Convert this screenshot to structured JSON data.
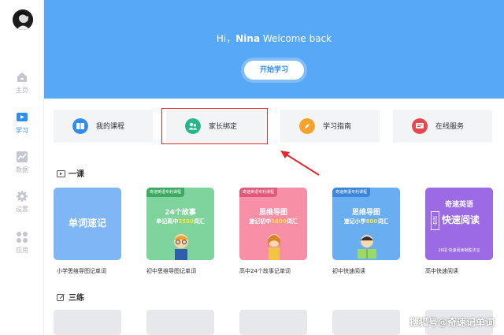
{
  "sidebar": {
    "items": [
      {
        "label": "主页"
      },
      {
        "label": "学习"
      },
      {
        "label": "数据"
      },
      {
        "label": "设置"
      },
      {
        "label": "应用"
      }
    ]
  },
  "hero": {
    "greeting_prefix": "Hi，",
    "user_name": "Nina",
    "greeting_suffix": "Welcome back",
    "start_button": "开始学习"
  },
  "quick_cards": [
    {
      "label": "我的课程"
    },
    {
      "label": "家长绑定"
    },
    {
      "label": "学习指南"
    },
    {
      "label": "在线服务"
    }
  ],
  "sections": {
    "lesson_title": "一课",
    "practice_title": "三练"
  },
  "books": [
    {
      "tag": "",
      "line1": "单词速记",
      "line2": "",
      "label": "小学思维导图记单词"
    },
    {
      "tag": "奇速英语专利课程",
      "line1": "24个故事",
      "line2_a": "串记高中",
      "line2_hl": "3500",
      "line2_b": "词汇",
      "label": "初中思维导图记单词"
    },
    {
      "tag": "奇速英语专利课程",
      "line1": "思维导图",
      "line2_a": "速记初中",
      "line2_hl": "1600",
      "line2_b": "词汇",
      "label": "高中24个故事记单词"
    },
    {
      "tag": "奇速英语专利课程",
      "line1": "思维导图",
      "line2_a": "速记小学",
      "line2_hl": "800",
      "line2_b": "词汇",
      "label": "初中快速阅读"
    },
    {
      "tag": "",
      "line1": "奇速英语",
      "line2_side": "初中",
      "line2_main": "快速阅读",
      "footer": "26招 快速阅读制胜法宝",
      "label": "高中快速阅读"
    }
  ],
  "watermark": "搜狐号@奇速记单词",
  "colors": {
    "hero_blue": "#57a9f7",
    "accent_blue": "#2f8df3",
    "highlight_red": "#e0282d"
  }
}
